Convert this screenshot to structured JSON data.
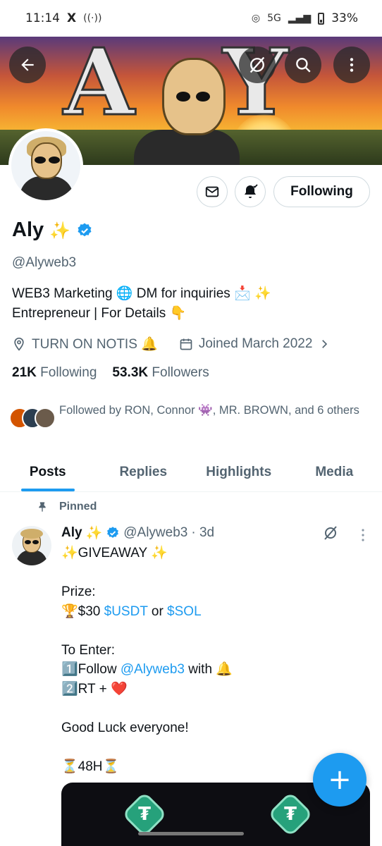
{
  "status_bar": {
    "time": "11:14",
    "x_icon": "X",
    "signal_label": "5G",
    "battery": "33%"
  },
  "header": {
    "back_icon": "back-arrow-icon",
    "grok_icon": "grok-icon",
    "search_icon": "search-icon",
    "more_icon": "more-vertical-icon"
  },
  "profile": {
    "name": "Aly",
    "name_emoji": "✨",
    "handle": "@Alyweb3",
    "bio_line1": "WEB3 Marketing 🌐 DM for inquiries 📩 ✨",
    "bio_line2": "Entrepreneur | For Details 👇",
    "location": "TURN ON NOTIS 🔔",
    "joined": "Joined March 2022",
    "following_count": "21K",
    "following_label": "Following",
    "followers_count": "53.3K",
    "followers_label": "Followers",
    "followed_by": "Followed by RON, Connor 👾, MR. BROWN, and 6 others",
    "follow_button": "Following"
  },
  "tabs": [
    {
      "label": "Posts",
      "active": true
    },
    {
      "label": "Replies",
      "active": false
    },
    {
      "label": "Highlights",
      "active": false
    },
    {
      "label": "Media",
      "active": false
    }
  ],
  "tweet": {
    "pinned_label": "Pinned",
    "author": "Aly",
    "author_emoji": "✨",
    "handle": "@Alyweb3",
    "time": "· 3d",
    "line1": "✨GIVEAWAY ✨",
    "line2": "Prize:",
    "line3_prefix": "🏆$30 ",
    "line3_link1": "$USDT",
    "line3_mid": " or ",
    "line3_link2": "$SOL",
    "line4": "To Enter:",
    "line5_prefix": "1️⃣Follow ",
    "line5_link": "@Alyweb3",
    "line5_suffix": " with 🔔",
    "line6": "2️⃣RT + ❤️",
    "line7": "Good Luck everyone!",
    "line8": "⏳48H⏳"
  },
  "fab_label": "+",
  "colors": {
    "accent": "#1d9bf0",
    "text_primary": "#0f1419",
    "text_secondary": "#536471"
  }
}
